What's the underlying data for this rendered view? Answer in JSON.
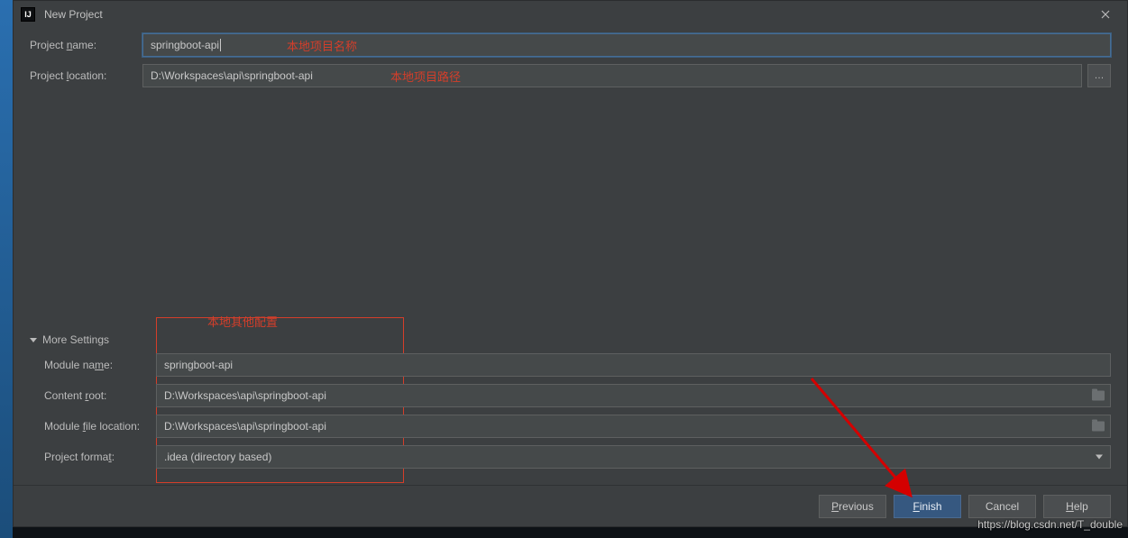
{
  "window": {
    "title": "New Project"
  },
  "fields": {
    "projectName": {
      "label_pre": "Project ",
      "label_mnem": "n",
      "label_post": "ame:",
      "value": "springboot-api"
    },
    "projectLocation": {
      "label_pre": "Project ",
      "label_mnem": "l",
      "label_post": "ocation:",
      "value": "D:\\Workspaces\\api\\springboot-api"
    }
  },
  "annotations": {
    "name": "本地项目名称",
    "location": "本地项目路径",
    "other": "本地其他配置"
  },
  "more": {
    "label": "More Settings",
    "moduleName": {
      "label_pre": "Module na",
      "label_mnem": "m",
      "label_post": "e:",
      "value": "springboot-api"
    },
    "contentRoot": {
      "label_pre": "Content ",
      "label_mnem": "r",
      "label_post": "oot:",
      "value": "D:\\Workspaces\\api\\springboot-api"
    },
    "moduleFileLocation": {
      "label_pre": "Module ",
      "label_mnem": "f",
      "label_post": "ile location:",
      "value": "D:\\Workspaces\\api\\springboot-api"
    },
    "projectFormat": {
      "label_pre": "Project forma",
      "label_mnem": "t",
      "label_post": ":",
      "value": ".idea (directory based)"
    }
  },
  "buttons": {
    "previous": {
      "mnem": "P",
      "rest": "revious"
    },
    "finish": {
      "mnem": "F",
      "rest": "inish"
    },
    "cancel": {
      "text": "Cancel"
    },
    "help": {
      "mnem": "H",
      "rest": "elp"
    }
  },
  "watermark": "https://blog.csdn.net/T_double"
}
